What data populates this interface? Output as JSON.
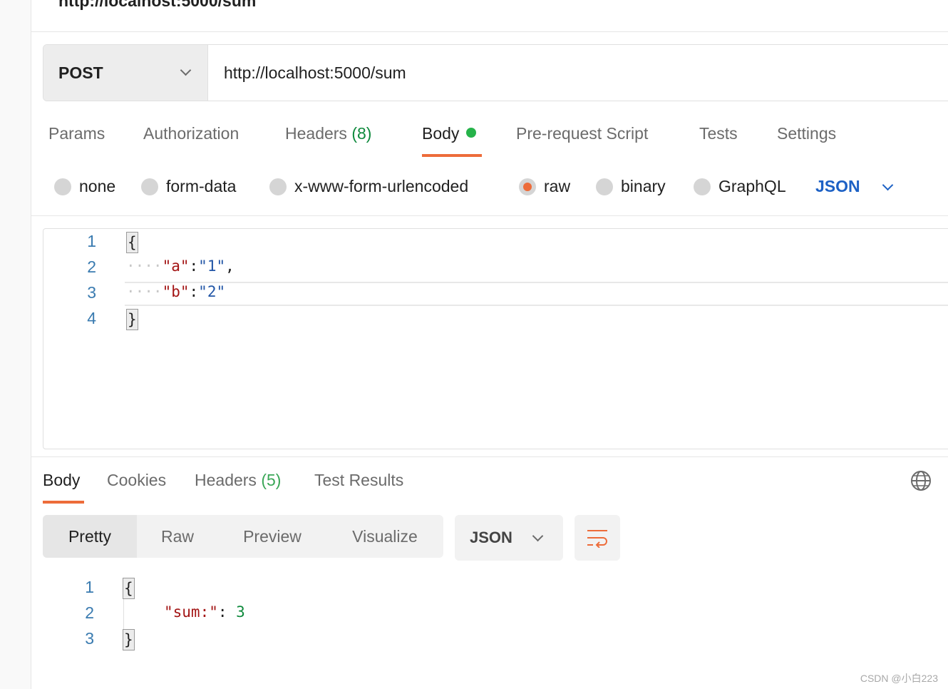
{
  "request": {
    "title": "http://localhost:5000/sum",
    "method": "POST",
    "url": "http://localhost:5000/sum",
    "tabs": [
      {
        "label": "Params"
      },
      {
        "label": "Authorization"
      },
      {
        "label": "Headers",
        "count": "(8)"
      },
      {
        "label": "Body"
      },
      {
        "label": "Pre-request Script"
      },
      {
        "label": "Tests"
      },
      {
        "label": "Settings"
      }
    ],
    "active_tab": "Body",
    "body_types": [
      "none",
      "form-data",
      "x-www-form-urlencoded",
      "raw",
      "binary",
      "GraphQL"
    ],
    "selected_body_type": "raw",
    "language": "JSON",
    "body_lines": [
      {
        "n": "1",
        "open": "{"
      },
      {
        "n": "2",
        "dots": "····",
        "key": "\"a\"",
        "colon": ":",
        "value": "\"1\"",
        "comma": ","
      },
      {
        "n": "3",
        "dots": "····",
        "key": "\"b\"",
        "colon": ":",
        "value": "\"2\""
      },
      {
        "n": "4",
        "close": "}"
      }
    ]
  },
  "response": {
    "tabs": [
      {
        "label": "Body"
      },
      {
        "label": "Cookies"
      },
      {
        "label": "Headers",
        "count": "(5)"
      },
      {
        "label": "Test Results"
      }
    ],
    "active_tab": "Body",
    "views": [
      "Pretty",
      "Raw",
      "Preview",
      "Visualize"
    ],
    "active_view": "Pretty",
    "format": "JSON",
    "body_lines": [
      {
        "n": "1",
        "open": "{"
      },
      {
        "n": "2",
        "key": "\"sum:\"",
        "colon": ": ",
        "value": "3"
      },
      {
        "n": "3",
        "close": "}"
      }
    ]
  },
  "icons": {
    "method_dropdown": "chevron-down-icon",
    "language_dropdown": "chevron-down-icon",
    "format_dropdown": "chevron-down-icon",
    "globe": "globe-icon",
    "wrap": "word-wrap-icon"
  },
  "colors": {
    "accent": "#ed6c3a",
    "link_blue": "#1d61c5",
    "count_green": "#0f8a3d",
    "status_dot": "#26b34a"
  },
  "watermark": "CSDN @小白223"
}
